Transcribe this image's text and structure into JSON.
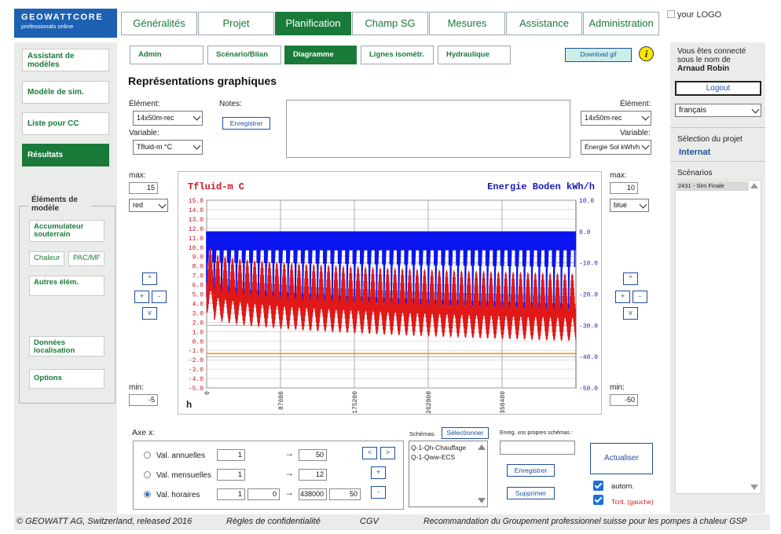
{
  "logo": {
    "line1": "GEOWATTCORE",
    "line2": "professionals online"
  },
  "top_tabs": [
    "Généralités",
    "Projet",
    "Planification",
    "Champ SG",
    "Mesures",
    "Assistance",
    "Administration"
  ],
  "your_logo": "your LOGO",
  "sidebar": {
    "items": [
      "Assistant de modèles",
      "Modèle de sim.",
      "Liste pour CC",
      "Résultats"
    ],
    "elements_title": "Éléments de modèle",
    "elements": {
      "accumulateur": "Accumulateur souterrain",
      "chaleur": "Chaleur",
      "pac": "PAC/MF",
      "autres": "Autres élém.",
      "donnees": "Données localisation",
      "options": "Options"
    }
  },
  "sub_tabs": [
    "Admin",
    "Scénario/Bilan",
    "Diagramme",
    "Lignes isométr.",
    "Hydraulique"
  ],
  "download_label": "Download gif",
  "info_icon": "i",
  "page_title": "Représentations graphiques",
  "left_controls": {
    "element_label": "Élément:",
    "element_value": "14x50m-rec",
    "variable_label": "Variable:",
    "variable_value": "Tfluid-m °C",
    "max_label": "max:",
    "max_value": "15",
    "color_value": "red",
    "min_label": "min:",
    "min_value": "-5"
  },
  "notes": {
    "label": "Notes:",
    "save_label": "Enregistrer"
  },
  "right_controls": {
    "element_label": "Élément:",
    "element_value": "14x50m-rec",
    "variable_label": "Variable:",
    "variable_value": "Énergie Sol kWh/h",
    "max_label": "max:",
    "max_value": "10",
    "color_value": "blue",
    "min_label": "min:",
    "min_value": "-50"
  },
  "arrows": {
    "up": "^",
    "plus": "+",
    "minus": "-",
    "down": "v"
  },
  "chart_data": {
    "type": "line",
    "left_title": "Tfluid-m C",
    "right_title": "Energie Boden kWh/h",
    "xlabel": "h",
    "xlim": [
      0,
      438000
    ],
    "xticks": [
      "0",
      "87600",
      "175200",
      "262800",
      "350400"
    ],
    "y_left": {
      "lim": [
        -5,
        15
      ],
      "ticks": [
        "15.0",
        "14.0",
        "13.0",
        "12.0",
        "11.0",
        "10.0",
        "9.0",
        "8.0",
        "7.0",
        "6.0",
        "5.0",
        "4.0",
        "3.0",
        "2.0",
        "1.0",
        "0.0",
        "-1.0",
        "-2.0",
        "-3.0",
        "-4.0",
        "-5.0"
      ]
    },
    "y_right": {
      "lim": [
        -50,
        10
      ],
      "ticks": [
        "10.0",
        "0.0",
        "-10.0",
        "-20.0",
        "-30.0",
        "-40.0",
        "-50.0"
      ]
    },
    "grid": true,
    "series": [
      {
        "name": "Tfluid-m C",
        "color": "#e01818",
        "axis": "left",
        "summer_max_start": 9.9,
        "summer_max_end": 7.2,
        "winter_min_start": 3.0,
        "winter_min_end": 0.0
      },
      {
        "name": "Energie Boden kWh/h",
        "color": "#0a14ef",
        "axis": "right",
        "upper": 0.0,
        "winter_min_start": -21.0,
        "winter_min_end": -25.0
      },
      {
        "name": "",
        "color": "#ee9a1a",
        "axis": "right",
        "value": -39.0
      }
    ]
  },
  "axis_x": {
    "title": "Axe x:",
    "rows": [
      {
        "label": "Val. annuelles",
        "from": "1",
        "to": "50",
        "selected": false
      },
      {
        "label": "Val. mensuelles",
        "from": "1",
        "to": "12",
        "selected": false
      },
      {
        "label": "Val. horaires",
        "from": "1",
        "from2": "0",
        "to": "438000",
        "to2": "50",
        "selected": true
      }
    ],
    "arrow_symbol": "→",
    "nav": {
      "prev": "<",
      "next": ">",
      "plus": "+",
      "minus": "-"
    }
  },
  "schemas": {
    "label": "Schémas:",
    "select_label": "Sélectionner",
    "items": [
      "Q-1-Qh-Chauffage",
      "Q-1-Qww-ECS"
    ],
    "own_label": "Enreg. vos propres schémas :",
    "save_label": "Enregistrer",
    "delete_label": "Supprimer"
  },
  "refresh": {
    "label": "Actualiser",
    "autom_label": "autom.",
    "tcrit_label": "Tcrit. (gauche)"
  },
  "right_panel": {
    "connected_line1": "Vous êtes connecté",
    "connected_line2": "sous le nom de",
    "user": "Arnaud Robin",
    "logout": "Logout",
    "language": "français",
    "project_label": "Sélection du projet",
    "project": "Internat",
    "scenarios_label": "Scénarios",
    "scenario_item": "2431 - Sim Finale"
  },
  "footer": {
    "copyright": "© GEOWATT AG, Switzerland, released 2016",
    "privacy": "Règles de confidentialité",
    "cgv": "CGV",
    "recommendation": "Recommandation du Groupement professionnel suisse pour les pompes à chaleur GSP"
  },
  "colors": {
    "brand_blue": "#1e61b3",
    "active_green": "#1a7a3a",
    "link_blue": "#1e4f9e",
    "panel_gray": "#e9ece8"
  }
}
